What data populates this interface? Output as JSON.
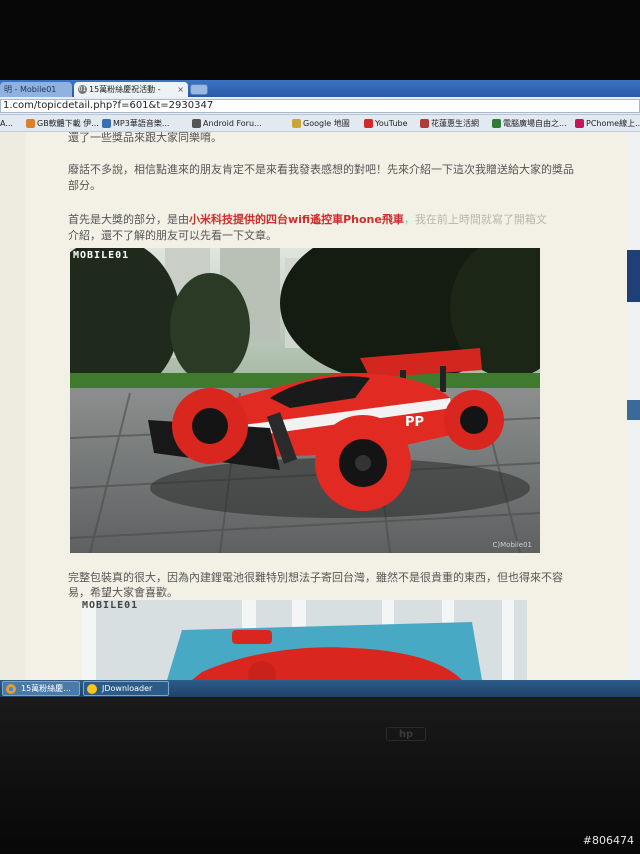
{
  "tabs": [
    {
      "label": "明 - Mobile01",
      "state": "inactive"
    },
    {
      "label": "15萬粉絲慶祝活動 - ",
      "state": "active",
      "favicon": "01",
      "close": "×"
    }
  ],
  "address": {
    "url_main": "1.com/topicdetail.php?f=601&t=2930347"
  },
  "bookmarks": [
    {
      "label": "A...",
      "icon_color": "#9aa0a6"
    },
    {
      "label": "GB軟體下載 伊...",
      "icon_color": "#d9822b"
    },
    {
      "label": "MP3華語音樂...",
      "icon_color": "#3a6fb0"
    },
    {
      "label": "Android Foru...",
      "icon_color": "#555555"
    },
    {
      "label": "Google 地圖",
      "icon_color": "#c8a536"
    },
    {
      "label": "YouTube",
      "icon_color": "#d22a2a"
    },
    {
      "label": "花蓮惠生活網",
      "icon_color": "#b03a3a"
    },
    {
      "label": "電腦廣場自由之...",
      "icon_color": "#2e7d32"
    },
    {
      "label": "PChome線上...",
      "icon_color": "#c2185b"
    }
  ],
  "article": {
    "line1": "還了一些獎品來跟大家同樂唷。",
    "line2a": "廢話不多說，相信點進來的朋友肯定不是來看我發表感想的對吧！先來介紹一下這次我贈送給大家的獎品",
    "line2b": "部分。",
    "line3_pre": "首先是大獎的部分，是由",
    "line3_highlight": "小米科技提供的四台wifi遙控車Phone飛車",
    "line3_post": "，我在前上時間就寫了開箱文",
    "line4": "介紹，還不了解的朋友可以先看一下文章。",
    "line5": "完整包裝真的很大，因為內建鋰電池很難特別想法子寄回台灣，雖然不是很貴重的東西，但也得來不容",
    "line6": "易，希望大家會喜歡。"
  },
  "photo": {
    "logo": "MOBILE01",
    "credit": "C)Mobile01"
  },
  "photo2": {
    "logo": "MOBILE01"
  },
  "taskbar": [
    {
      "label": "15萬粉絲慶...",
      "icon_color": "#e0a02a"
    },
    {
      "label": "JDownloader",
      "icon_color": "#f5c518"
    }
  ],
  "watermark": "#806474",
  "colors": {
    "tab_strip": "#3b74c4",
    "highlight_red": "#cf2d2d",
    "page_bg": "#f3f1e6"
  }
}
